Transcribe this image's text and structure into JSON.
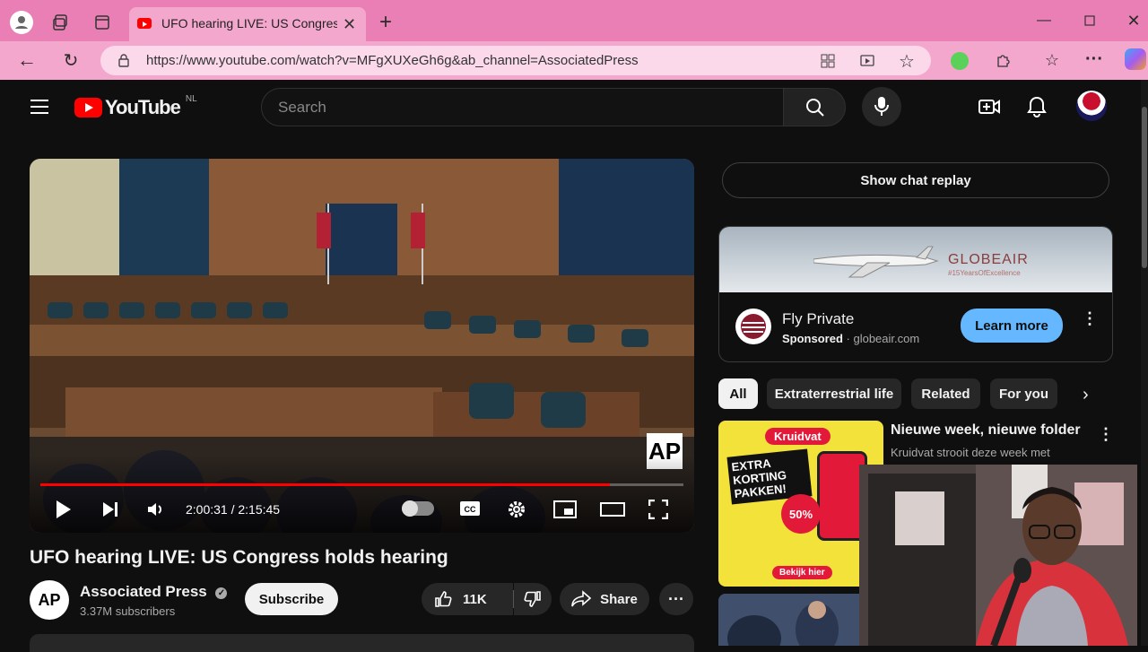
{
  "browser": {
    "tab_title": "UFO hearing LIVE: US Congress holds hearing",
    "url": "https://www.youtube.com/watch?v=MFgXUXeGh6g&ab_channel=AssociatedPress"
  },
  "yt": {
    "logo_text": "YouTube",
    "region": "NL",
    "search_placeholder": "Search"
  },
  "player": {
    "time": "2:00:31 / 2:15:45",
    "progress": 0.885,
    "watermark": "AP"
  },
  "video": {
    "title": "UFO hearing LIVE: US Congress holds hearing",
    "channel": "Associated Press",
    "channel_avatar": "AP",
    "subscribers": "3.37M subscribers",
    "subscribe_label": "Subscribe",
    "likes": "11K",
    "share_label": "Share"
  },
  "sidebar": {
    "chat_replay": "Show chat replay",
    "ad": {
      "brand_title": "Fly Private",
      "sponsored": "Sponsored",
      "domain": "· globeair.com",
      "cta": "Learn more",
      "banner_brand": "GLOBEAIR",
      "banner_tag": "#15YearsOfExcellence"
    },
    "chips": [
      "All",
      "Extraterrestrial life",
      "Related",
      "For you"
    ],
    "rec": {
      "title": "Nieuwe week, nieuwe folder",
      "desc": "Kruidvat strooit deze week met",
      "thumb_brand": "Kruidvat",
      "thumb_text": "EXTRA KORTING PAKKEN!",
      "thumb_pct": "50%",
      "thumb_cta": "Bekijk hier"
    }
  },
  "colors": {
    "accent": "#ff0000",
    "pink_chrome": "#e97fb4",
    "learn_more": "#65b8ff"
  }
}
